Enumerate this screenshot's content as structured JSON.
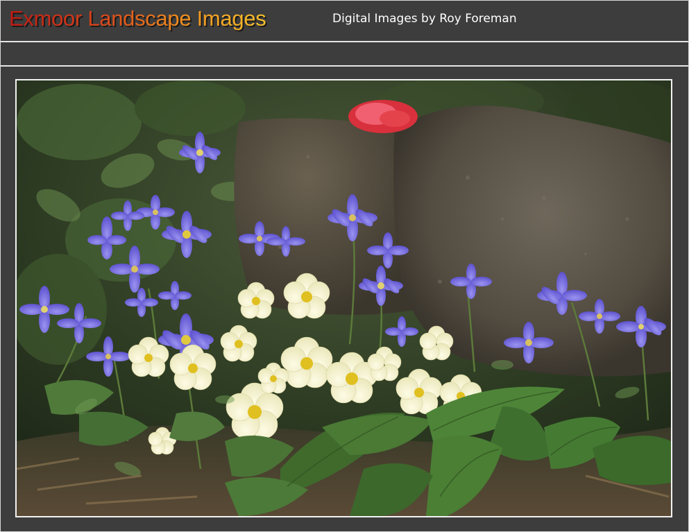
{
  "header": {
    "site_title": "Exmoor Landscape Images",
    "site_subtitle": "Digital Images by Roy Foreman",
    "title_gradient": [
      "#c01a12",
      "#f08a1d",
      "#f7c22c"
    ]
  },
  "navbar": {
    "items": []
  },
  "photo": {
    "subject": "spring-flowers-photo",
    "colors": {
      "frame": "#f2f2f2",
      "background": "#3d3d3d",
      "anemone": "#6a5fd8",
      "primrose": "#f3f0c8",
      "primrose_center": "#e0c020",
      "rock": "#5d5649",
      "leaf": "#3f6a2c",
      "red_flower": "#e5434c"
    }
  }
}
